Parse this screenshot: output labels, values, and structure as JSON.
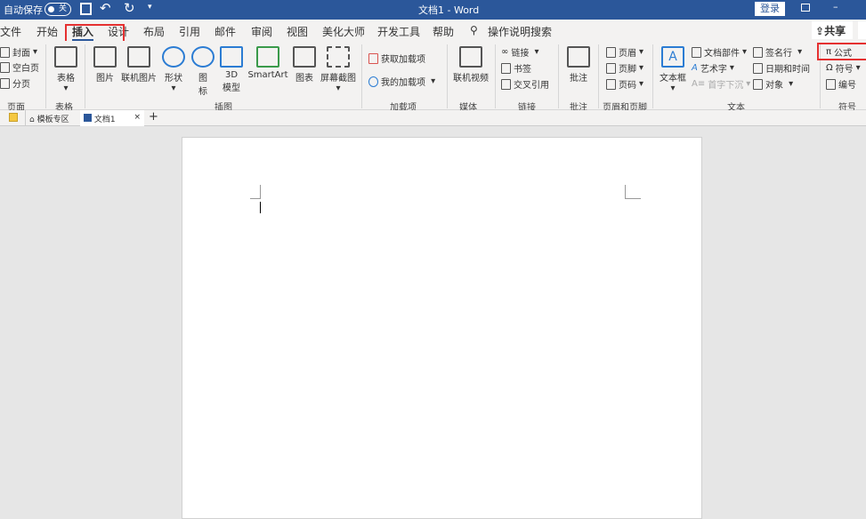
{
  "titlebar": {
    "autosave": "自动保存",
    "toggle": "关",
    "title": "文档1  -  Word",
    "login": "登录"
  },
  "tabs": [
    "文件",
    "开始",
    "插入",
    "设计",
    "布局",
    "引用",
    "邮件",
    "审阅",
    "视图",
    "美化大师",
    "开发工具",
    "帮助"
  ],
  "search": "操作说明搜索",
  "share": "共享",
  "ribbon": {
    "page": {
      "items": [
        "封面",
        "空白页",
        "分页"
      ],
      "label": "页面"
    },
    "table": {
      "item": "表格",
      "label": "表格"
    },
    "illustrations": {
      "items": [
        "图片",
        "联机图片",
        "形状",
        "图\n标",
        "3D\n模型",
        "SmartArt",
        "图表",
        "屏幕截图"
      ],
      "label": "插图"
    },
    "addins": {
      "items": [
        "获取加载项",
        "我的加载项"
      ],
      "label": "加载项"
    },
    "media": {
      "item": "联机视频",
      "label": "媒体"
    },
    "links": {
      "items": [
        "链接",
        "书签",
        "交叉引用"
      ],
      "label": "链接"
    },
    "comments": {
      "item": "批注",
      "label": "批注"
    },
    "headerfooter": {
      "items": [
        "页眉",
        "页脚",
        "页码"
      ],
      "label": "页眉和页脚"
    },
    "text": {
      "textbox": "文本框",
      "items": [
        "文档部件",
        "艺术字",
        "首字下沉",
        "签名行",
        "日期和时间",
        "对象"
      ],
      "label": "文本"
    },
    "symbols": {
      "items": [
        "公式",
        "符号",
        "编号"
      ],
      "label": "符号"
    }
  },
  "doctabs": {
    "template": "模板专区",
    "doc": "文档1"
  }
}
